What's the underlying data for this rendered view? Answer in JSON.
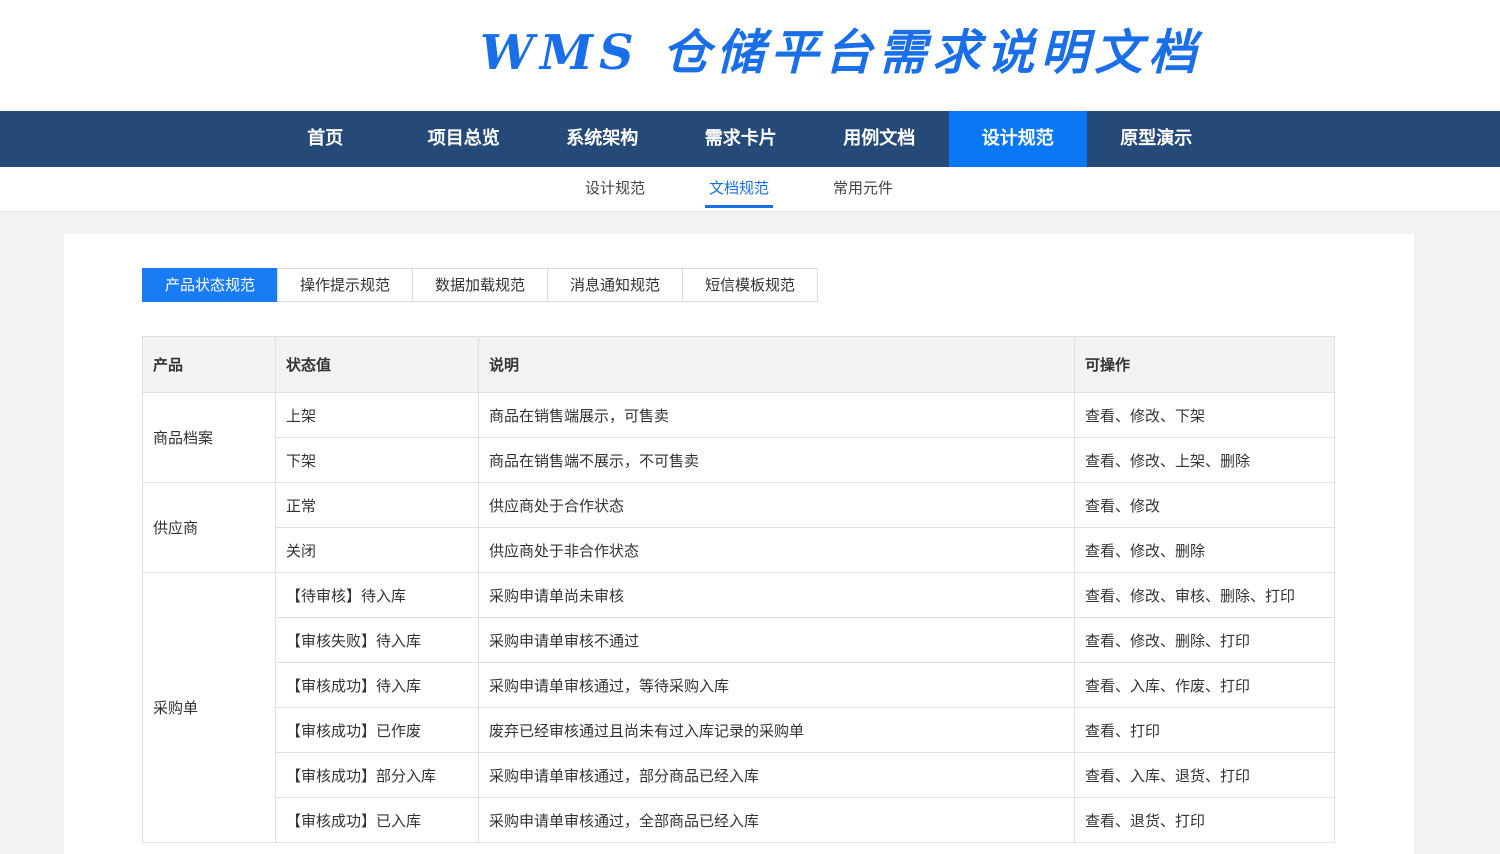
{
  "header": {
    "title": "WMS 仓储平台需求说明文档"
  },
  "main_nav": {
    "items": [
      "首页",
      "项目总览",
      "系统架构",
      "需求卡片",
      "用例文档",
      "设计规范",
      "原型演示"
    ],
    "active": "设计规范"
  },
  "sub_nav": {
    "items": [
      "设计规范",
      "文档规范",
      "常用元件"
    ],
    "active": "文档规范"
  },
  "tabs": {
    "items": [
      "产品状态规范",
      "操作提示规范",
      "数据加载规范",
      "消息通知规范",
      "短信模板规范"
    ],
    "active": "产品状态规范"
  },
  "table": {
    "headers": [
      "产品",
      "状态值",
      "说明",
      "可操作"
    ],
    "groups": [
      {
        "product": "商品档案",
        "rows": [
          {
            "status": "上架",
            "desc": "商品在销售端展示，可售卖",
            "ops": "查看、修改、下架"
          },
          {
            "status": "下架",
            "desc": "商品在销售端不展示，不可售卖",
            "ops": "查看、修改、上架、删除"
          }
        ]
      },
      {
        "product": "供应商",
        "rows": [
          {
            "status": "正常",
            "desc": "供应商处于合作状态",
            "ops": "查看、修改"
          },
          {
            "status": "关闭",
            "desc": "供应商处于非合作状态",
            "ops": "查看、修改、删除"
          }
        ]
      },
      {
        "product": "采购单",
        "rows": [
          {
            "status": "【待审核】待入库",
            "desc": "采购申请单尚未审核",
            "ops": "查看、修改、审核、删除、打印"
          },
          {
            "status": "【审核失败】待入库",
            "desc": "采购申请单审核不通过",
            "ops": "查看、修改、删除、打印"
          },
          {
            "status": "【审核成功】待入库",
            "desc": "采购申请单审核通过，等待采购入库",
            "ops": "查看、入库、作废、打印"
          },
          {
            "status": "【审核成功】已作废",
            "desc": "废弃已经审核通过且尚未有过入库记录的采购单",
            "ops": "查看、打印"
          },
          {
            "status": "【审核成功】部分入库",
            "desc": "采购申请单审核通过，部分商品已经入库",
            "ops": "查看、入库、退货、打印"
          },
          {
            "status": "【审核成功】已入库",
            "desc": "采购申请单审核通过，全部商品已经入库",
            "ops": "查看、退货、打印"
          }
        ]
      }
    ]
  },
  "colors": {
    "nav_bg": "#254a78",
    "accent": "#0a78f5",
    "title": "#1a6fe8"
  }
}
